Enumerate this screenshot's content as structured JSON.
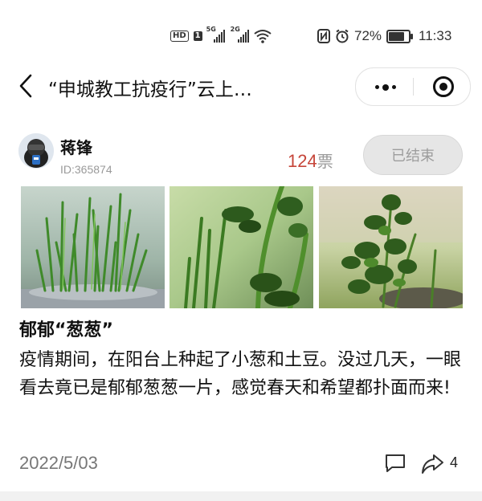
{
  "status_bar": {
    "left_icons": [
      "hd-icon",
      "sim1-5g-signal-icon",
      "sim2-2g-signal-icon",
      "wifi-icon"
    ],
    "hd_text": "HD",
    "sim1_tag": "5G",
    "sim2_tag": "2G",
    "battery_percent": "72%",
    "battery_level": 0.72,
    "time": "11:33",
    "right_icons": [
      "nfc-icon",
      "alarm-icon",
      "battery-icon"
    ]
  },
  "nav": {
    "title": "“申城教工抗疫行”云上…",
    "back_icon": "back-arrow-icon",
    "more_icon": "more-dots-icon",
    "close_icon": "record-close-icon"
  },
  "entry": {
    "author_name": "蒋锋",
    "author_id": "ID:365874",
    "vote_count": "124",
    "vote_unit": "票",
    "status_button": "已结束",
    "post_title": "郁郁“葱葱”",
    "post_body": "疫情期间，在阳台上种起了小葱和土豆。没过几天，一眼看去竟已是郁郁葱葱一片，感觉春天和希望都扑面而来!",
    "date": "2022/5/03",
    "share_count": "4",
    "accent_color": "#c6463a"
  }
}
